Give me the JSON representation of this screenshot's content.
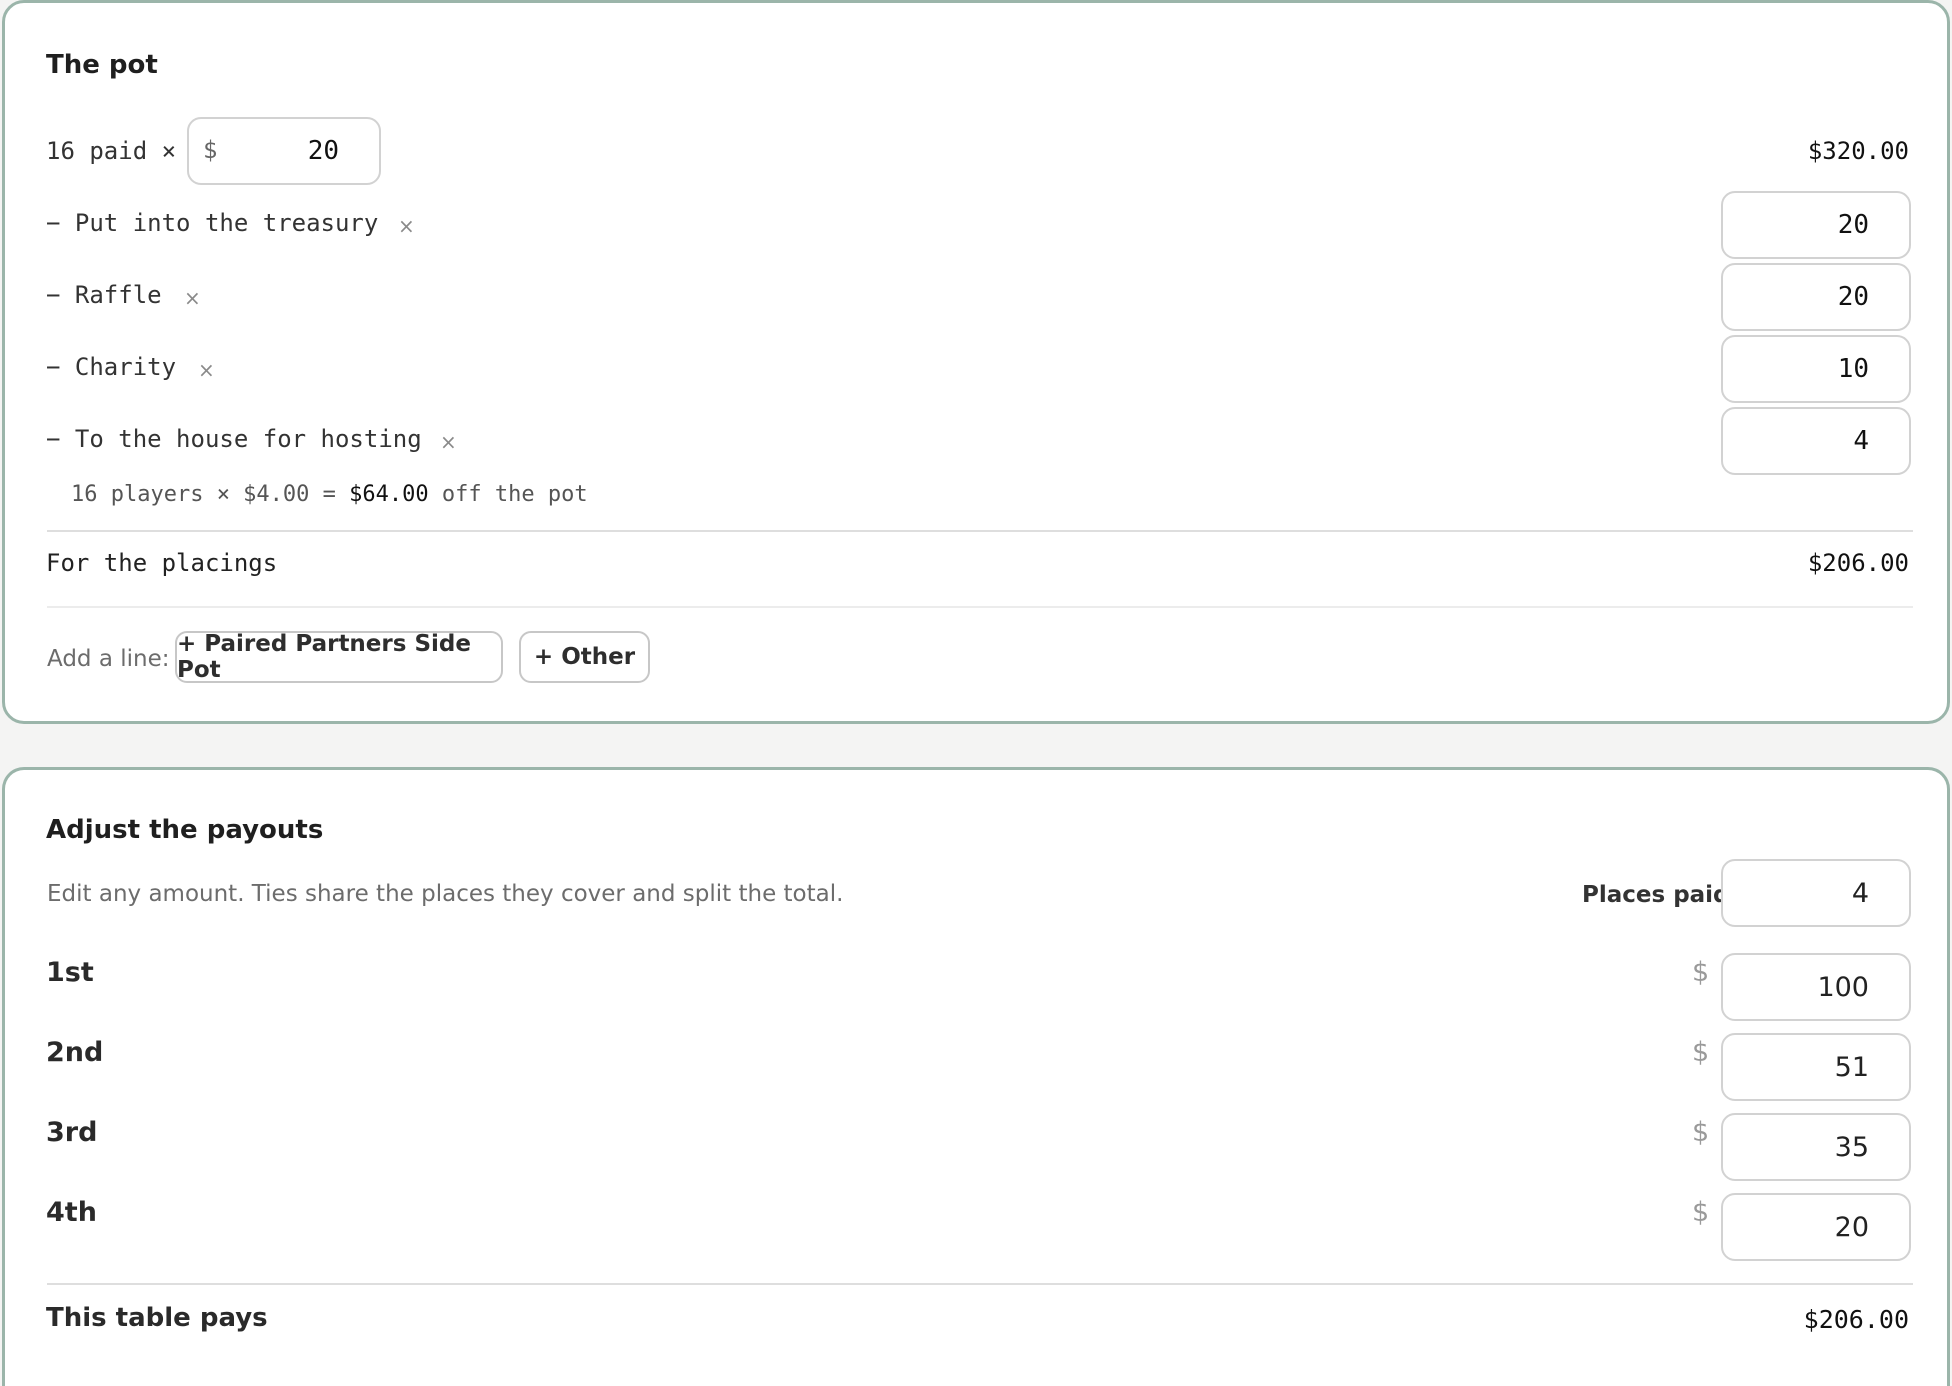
{
  "pot": {
    "title": "The pot",
    "entry": {
      "prefix": "16 paid ×",
      "currency": "$",
      "fee": "20",
      "total": "$320.00"
    },
    "deductions": [
      {
        "label": "− Put into the treasury",
        "value": "20"
      },
      {
        "label": "− Raffle",
        "value": "20"
      },
      {
        "label": "− Charity",
        "value": "10"
      },
      {
        "label": "− To the house for hosting",
        "value": "4"
      }
    ],
    "remove_glyph": "×",
    "house_note": {
      "prefix": "16 players × $4.00 = ",
      "amount": "$64.00",
      "suffix": " off the pot"
    },
    "placings_label": "For the placings",
    "placings_total": "$206.00",
    "add_line_label": "Add a line:",
    "add_buttons": [
      "+ Paired Partners Side Pot",
      "+ Other"
    ]
  },
  "payouts": {
    "title": "Adjust the payouts",
    "hint": "Edit any amount. Ties share the places they cover and split the total.",
    "places_paid_label": "Places paid",
    "places_paid": "4",
    "currency": "$",
    "places": [
      {
        "label": "1st",
        "amount": "100"
      },
      {
        "label": "2nd",
        "amount": "51"
      },
      {
        "label": "3rd",
        "amount": "35"
      },
      {
        "label": "4th",
        "amount": "20"
      }
    ],
    "total_label": "This table pays",
    "total": "$206.00"
  },
  "colors": {
    "card_border": "#9bb5aa",
    "background": "#f4f4f3"
  }
}
